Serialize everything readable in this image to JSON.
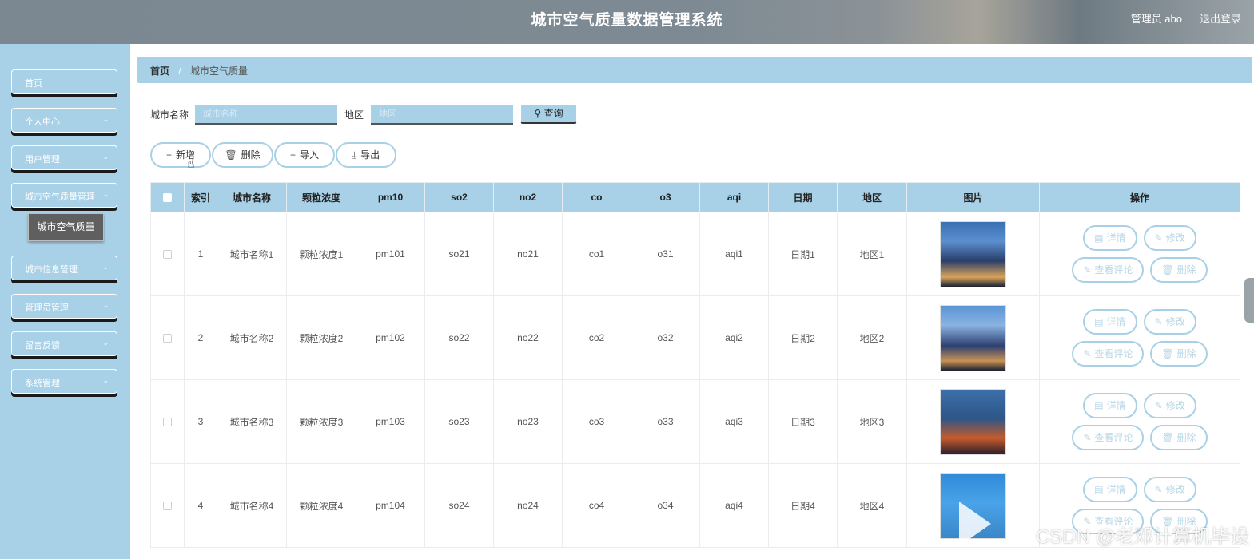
{
  "header": {
    "title": "城市空气质量数据管理系统",
    "user": "管理员 abo",
    "logout": "退出登录"
  },
  "sidebar": {
    "items": [
      {
        "label": "首页",
        "has_chevron": false
      },
      {
        "label": "个人中心",
        "has_chevron": true
      },
      {
        "label": "用户管理",
        "has_chevron": true
      },
      {
        "label": "城市空气质量管理",
        "has_chevron": true
      },
      {
        "label": "城市信息管理",
        "has_chevron": true
      },
      {
        "label": "管理员管理",
        "has_chevron": true
      },
      {
        "label": "留言反馈",
        "has_chevron": true
      },
      {
        "label": "系统管理",
        "has_chevron": true
      }
    ],
    "active_sub": "城市空气质量",
    "chevron_icon": "chevron-down-icon"
  },
  "breadcrumb": {
    "home": "首页",
    "separator": "/",
    "current": "城市空气质量"
  },
  "search": {
    "city_label": "城市名称",
    "city_placeholder": "城市名称",
    "region_label": "地区",
    "region_placeholder": "地区",
    "query_label": "查询",
    "query_icon": "search-icon"
  },
  "actions": {
    "add": "新增",
    "delete": "删除",
    "import": "导入",
    "export": "导出"
  },
  "table": {
    "columns": [
      "索引",
      "城市名称",
      "颗粒浓度",
      "pm10",
      "so2",
      "no2",
      "co",
      "o3",
      "aqi",
      "日期",
      "地区",
      "图片",
      "操作"
    ],
    "rows": [
      {
        "index": "1",
        "city": "城市名称1",
        "particle": "颗粒浓度1",
        "pm10": "pm101",
        "so2": "so21",
        "no2": "no21",
        "co": "co1",
        "o3": "o31",
        "aqi": "aqi1",
        "date": "日期1",
        "region": "地区1",
        "image": "city-night-skyline"
      },
      {
        "index": "2",
        "city": "城市名称2",
        "particle": "颗粒浓度2",
        "pm10": "pm102",
        "so2": "so22",
        "no2": "no22",
        "co": "co2",
        "o3": "o32",
        "aqi": "aqi2",
        "date": "日期2",
        "region": "地区2",
        "image": "city-night-skyline"
      },
      {
        "index": "3",
        "city": "城市名称3",
        "particle": "颗粒浓度3",
        "pm10": "pm103",
        "so2": "so23",
        "no2": "no23",
        "co": "co3",
        "o3": "o33",
        "aqi": "aqi3",
        "date": "日期3",
        "region": "地区3",
        "image": "city-tower-night"
      },
      {
        "index": "4",
        "city": "城市名称4",
        "particle": "颗粒浓度4",
        "pm10": "pm104",
        "so2": "so24",
        "no2": "no24",
        "co": "co4",
        "o3": "o34",
        "aqi": "aqi4",
        "date": "日期4",
        "region": "地区4",
        "image": "weather-app"
      }
    ],
    "row_ops": {
      "detail": "详情",
      "edit": "修改",
      "view_comments": "查看评论",
      "delete": "删除"
    }
  },
  "watermark": "CSDN @老邓计算机毕设",
  "colors": {
    "primary": "#a8d0e6",
    "active_sub_bg": "#5f5f5f"
  }
}
